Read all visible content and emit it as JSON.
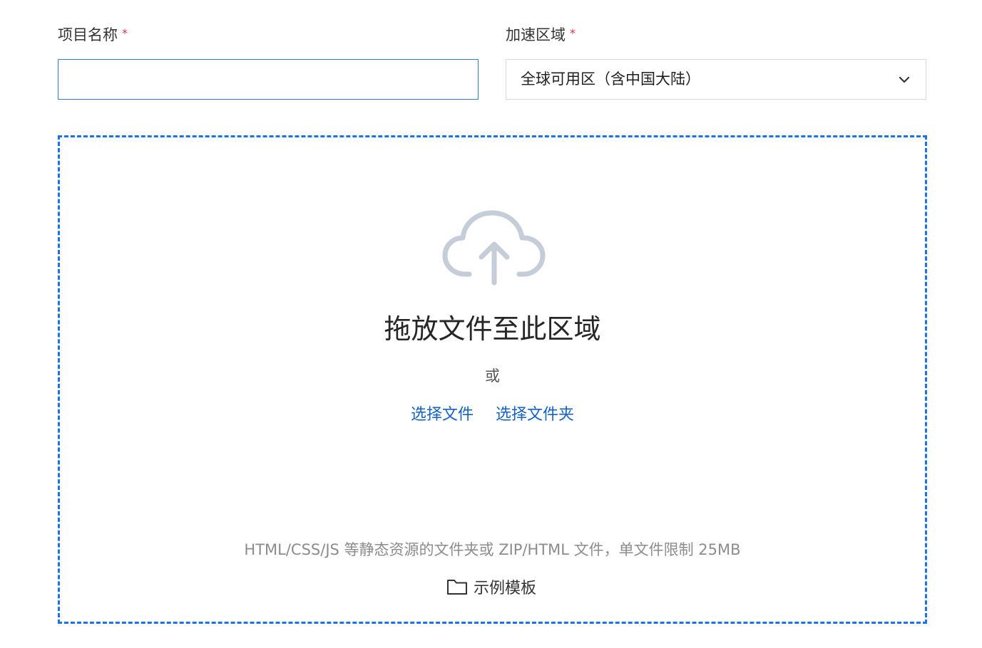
{
  "form": {
    "project_name": {
      "label": "项目名称",
      "required_mark": "*",
      "value": "",
      "placeholder": ""
    },
    "region": {
      "label": "加速区域",
      "required_mark": "*",
      "selected": "全球可用区（含中国大陆）",
      "icon": "chevron-down-icon"
    }
  },
  "upload": {
    "icon": "cloud-upload-icon",
    "title": "拖放文件至此区域",
    "or_text": "或",
    "select_file": "选择文件",
    "select_folder": "选择文件夹",
    "hint": "HTML/CSS/JS 等静态资源的文件夹或 ZIP/HTML 文件，单文件限制 25MB",
    "template_icon": "folder-icon",
    "template_label": "示例模板"
  },
  "colors": {
    "accent": "#1a73e8",
    "link": "#1562c4",
    "required": "#d9363e",
    "icon_gray": "#c5cdd9"
  }
}
